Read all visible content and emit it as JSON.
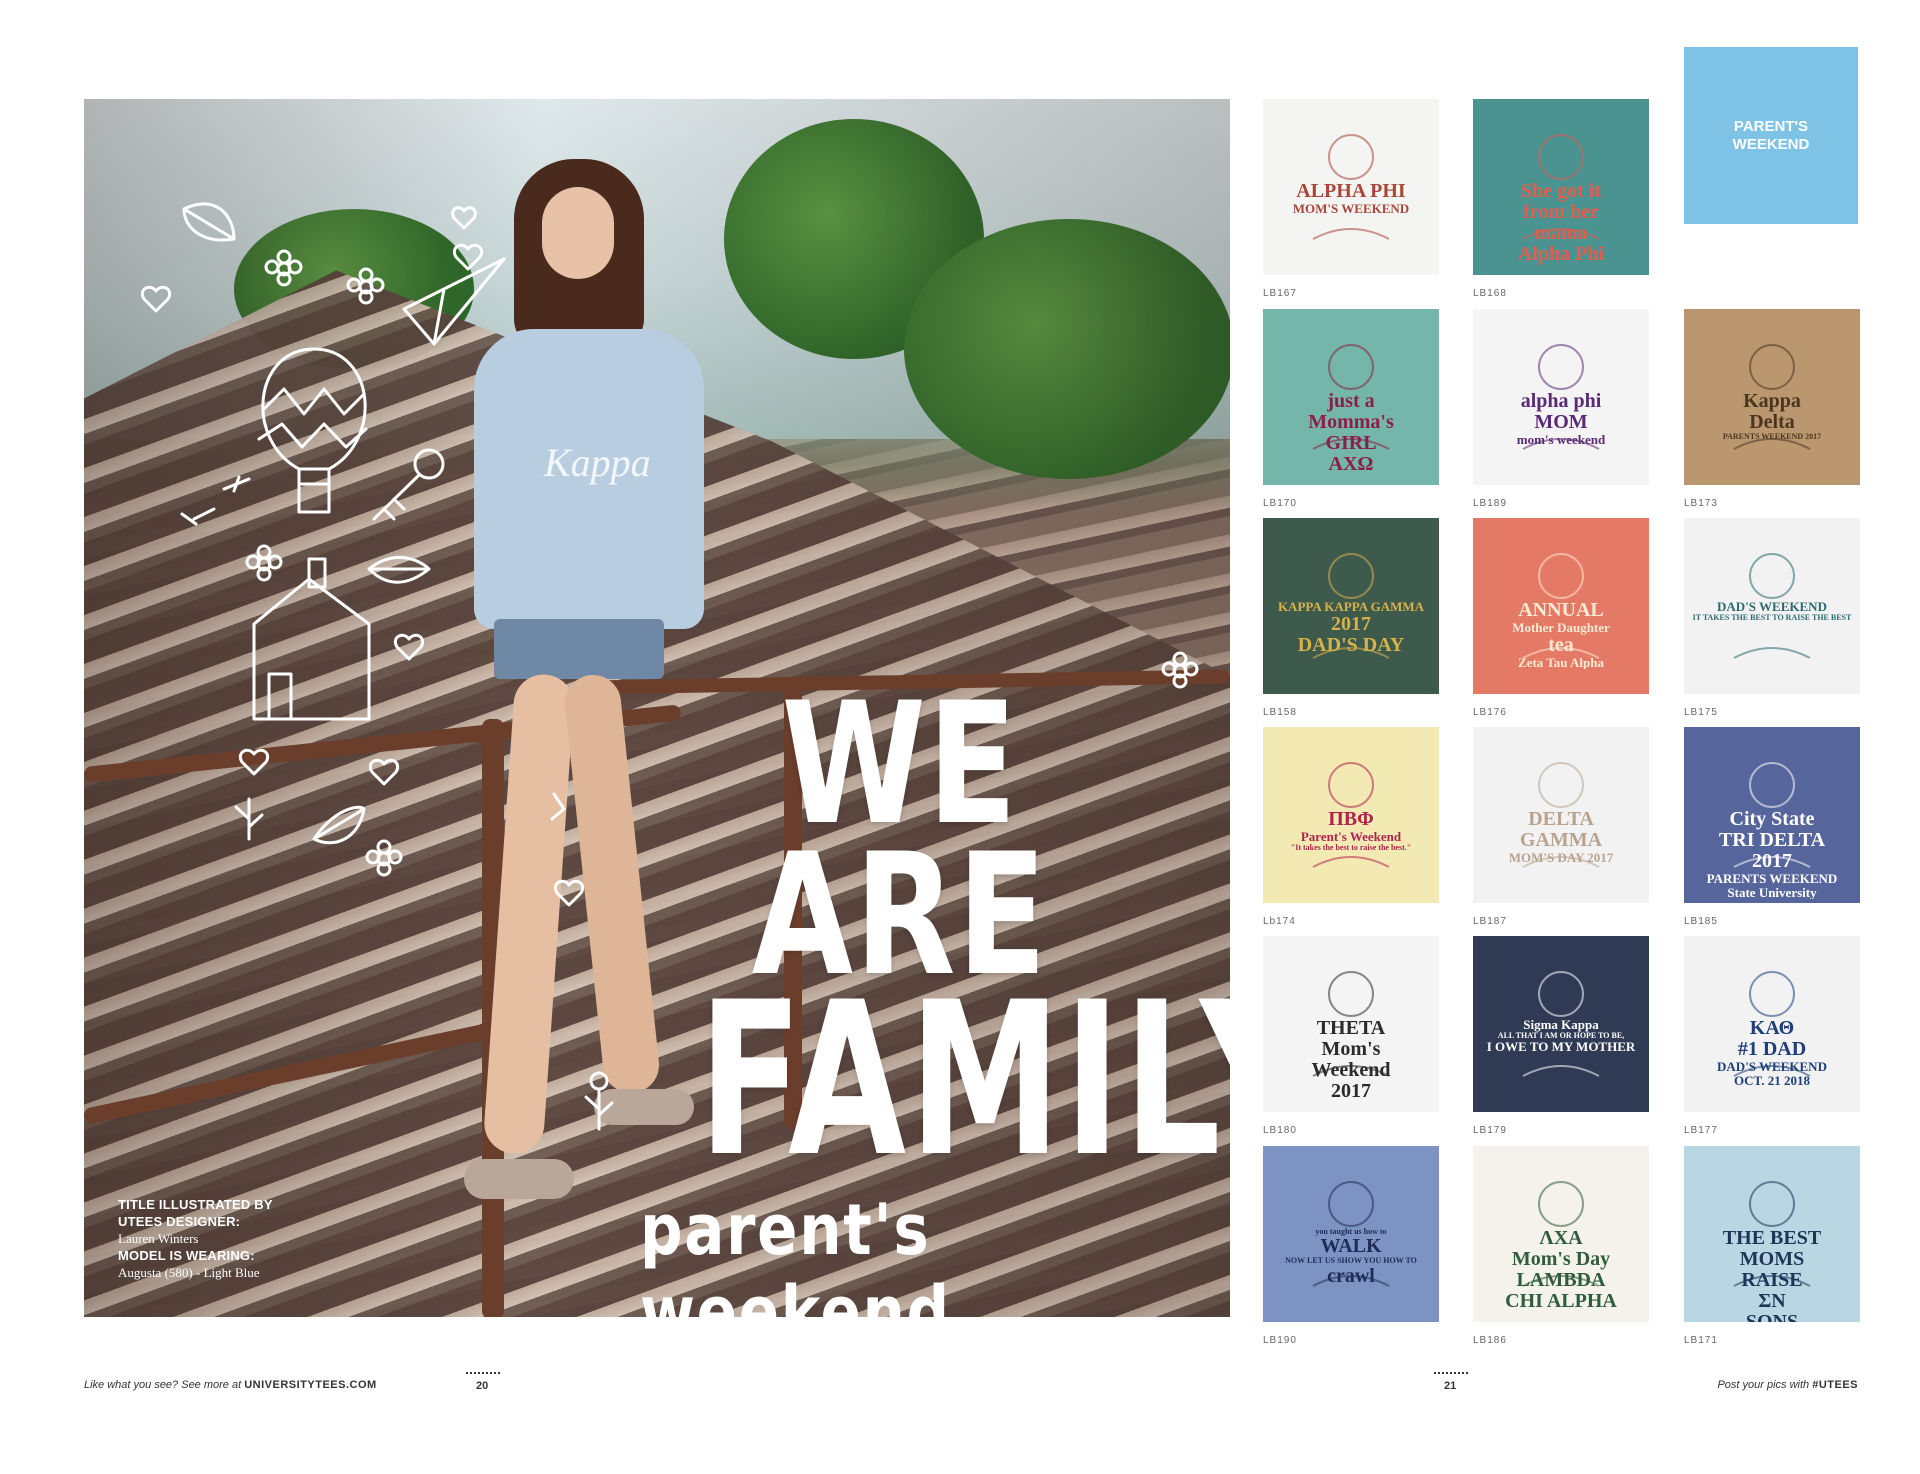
{
  "hero": {
    "headline_line1": "WE ARE",
    "headline_line2": "FAMILY",
    "subheadline": "parent's weekend",
    "shirt_text": "Kappa",
    "credits": {
      "illustrated_label_1": "TITLE ILLUSTRATED BY",
      "illustrated_label_2": "UTEES DESIGNER:",
      "designer_name": "Lauren Winters",
      "wearing_label": "MODEL IS WEARING:",
      "wearing_value": "Augusta (580) - Light Blue"
    }
  },
  "category_box": {
    "label": "PARENT'S WEEKEND",
    "color": "#7ec3e6"
  },
  "designs": [
    {
      "code": "LB167",
      "bg": "#f4f4f2",
      "lines": [
        "ALPHA PHI",
        "MOM'S WEEKEND"
      ],
      "ink": "#a9463a",
      "icon": "cactus-pots-icon"
    },
    {
      "code": "LB168",
      "bg": "#4b9390",
      "lines": [
        "She got it",
        "from her",
        "mama",
        "Alpha Phi"
      ],
      "ink": "#e35c4c",
      "icon": "floral-frame-icon"
    },
    {
      "code": "LB170",
      "bg": "#74b6a9",
      "lines": [
        "just a",
        "Momma's",
        "GIRL",
        "ΑΧΩ"
      ],
      "ink": "#8c1f4a",
      "icon": "shoes-icon"
    },
    {
      "code": "LB189",
      "bg": "#f4f4f4",
      "lines": [
        "alpha phi",
        "MOM",
        "mom's weekend"
      ],
      "ink": "#5b2a76",
      "icon": "floral-letters-icon"
    },
    {
      "code": "LB173",
      "bg": "#bb9770",
      "lines": [
        "Kappa",
        "Delta",
        "PARENTS WEEKEND 2017"
      ],
      "ink": "#4a3520",
      "icon": "autumn-tree-icon"
    },
    {
      "code": "LB158",
      "bg": "#3e5a4c",
      "lines": [
        "KAPPA KAPPA GAMMA",
        "2017",
        "DAD'S DAY"
      ],
      "ink": "#d6b24a",
      "icon": "kickline-icon"
    },
    {
      "code": "LB176",
      "bg": "#e47a66",
      "lines": [
        "ANNUAL",
        "Mother Daughter",
        "tea",
        "Zeta Tau Alpha"
      ],
      "ink": "#fbe9d4",
      "icon": "teapot-icon"
    },
    {
      "code": "LB175",
      "bg": "#f2f2f2",
      "lines": [
        "DAD'S WEEKEND",
        "IT TAKES THE BEST TO RAISE THE BEST"
      ],
      "ink": "#2c6a72",
      "icon": "trucks-icon"
    },
    {
      "code": "Lb174",
      "bg": "#f3e9b3",
      "lines": [
        "ΠΒΦ",
        "Parent's Weekend",
        "\"It takes the best to raise the best.\""
      ],
      "ink": "#b0234f",
      "icon": "stadium-icon"
    },
    {
      "code": "LB187",
      "bg": "#f2f2f2",
      "lines": [
        "DELTA",
        "GAMMA",
        "MOM'S DAY 2017"
      ],
      "ink": "#b8a48e",
      "icon": "mother-daughter-icon"
    },
    {
      "code": "LB185",
      "bg": "#56659c",
      "lines": [
        "City State",
        "TRI DELTA",
        "2017",
        "PARENTS WEEKEND",
        "State University"
      ],
      "ink": "#ffffff",
      "icon": "postcard-icon"
    },
    {
      "code": "LB180",
      "bg": "#f4f4f4",
      "lines": [
        "THETA",
        "Mom's",
        "Weekend",
        "2017"
      ],
      "ink": "#2b2b2b",
      "icon": "perfume-bottle-icon"
    },
    {
      "code": "LB179",
      "bg": "#2f3a55",
      "lines": [
        "Sigma Kappa",
        "ALL THAT I AM OR HOPE TO BE,",
        "I OWE TO MY MOTHER"
      ],
      "ink": "#ffffff",
      "icon": "flower-wreath-icon"
    },
    {
      "code": "LB177",
      "bg": "#f2f2f2",
      "lines": [
        "ΚΑΘ",
        "#1 DAD",
        "DAD'S WEEKEND",
        "OCT. 21 2018"
      ],
      "ink": "#1e3f7a",
      "icon": "grill-icon"
    },
    {
      "code": "LB190",
      "bg": "#7d93c4",
      "lines": [
        "you taught us how to",
        "WALK",
        "NOW LET US SHOW YOU HOW TO",
        "crawl"
      ],
      "ink": "#1f2d56",
      "icon": "houses-icon"
    },
    {
      "code": "LB186",
      "bg": "#f4f2ea",
      "lines": [
        "ΛΧΑ",
        "Mom's Day",
        "LAMBDA",
        "CHI ALPHA"
      ],
      "ink": "#2f5d3c",
      "icon": "vintage-stamp-icon"
    },
    {
      "code": "LB171",
      "bg": "#b9d6e3",
      "lines": [
        "THE BEST",
        "MOMS",
        "RAISE",
        "ΣΝ",
        "SONS"
      ],
      "ink": "#1f3558",
      "icon": "sports-mom-icon"
    }
  ],
  "footer": {
    "left_text": "Like what you see? See more at ",
    "left_site": "UNIVERSITYTEES.COM",
    "page_left": "20",
    "page_right": "21",
    "right_text": "Post your pics with ",
    "right_tag": "#UTEES"
  }
}
